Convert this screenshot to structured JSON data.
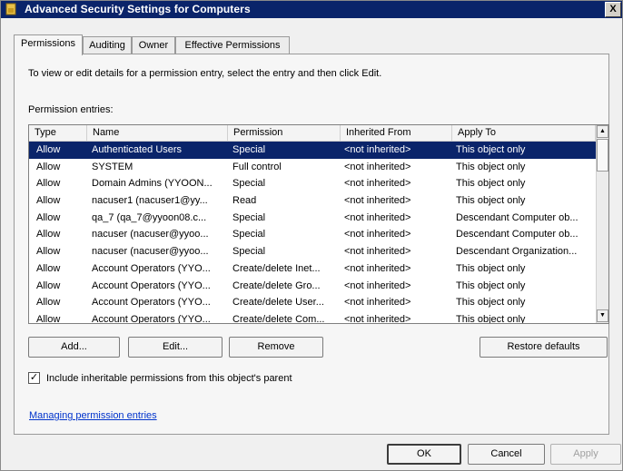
{
  "window": {
    "title": "Advanced Security Settings for Computers",
    "close_glyph": "X"
  },
  "tabs": [
    {
      "label": "Permissions",
      "active": true
    },
    {
      "label": "Auditing",
      "active": false
    },
    {
      "label": "Owner",
      "active": false
    },
    {
      "label": "Effective Permissions",
      "active": false
    }
  ],
  "instructions": "To view or edit details for a permission entry, select the entry and then click Edit.",
  "entries_label": "Permission entries:",
  "table": {
    "columns": [
      "Type",
      "Name",
      "Permission",
      "Inherited From",
      "Apply To"
    ],
    "rows": [
      [
        "Allow",
        "Authenticated Users",
        "Special",
        "<not inherited>",
        "This object only"
      ],
      [
        "Allow",
        "SYSTEM",
        "Full control",
        "<not inherited>",
        "This object only"
      ],
      [
        "Allow",
        "Domain Admins (YYOON...",
        "Special",
        "<not inherited>",
        "This object only"
      ],
      [
        "Allow",
        "nacuser1 (nacuser1@yy...",
        "Read",
        "<not inherited>",
        "This object only"
      ],
      [
        "Allow",
        "qa_7 (qa_7@yyoon08.c...",
        "Special",
        "<not inherited>",
        "Descendant Computer ob..."
      ],
      [
        "Allow",
        "nacuser (nacuser@yyoo...",
        "Special",
        "<not inherited>",
        "Descendant Computer ob..."
      ],
      [
        "Allow",
        "nacuser (nacuser@yyoo...",
        "Special",
        "<not inherited>",
        "Descendant Organization..."
      ],
      [
        "Allow",
        "Account Operators (YYO...",
        "Create/delete Inet...",
        "<not inherited>",
        "This object only"
      ],
      [
        "Allow",
        "Account Operators (YYO...",
        "Create/delete Gro...",
        "<not inherited>",
        "This object only"
      ],
      [
        "Allow",
        "Account Operators (YYO...",
        "Create/delete User...",
        "<not inherited>",
        "This object only"
      ],
      [
        "Allow",
        "Account Operators (YYO...",
        "Create/delete Com...",
        "<not inherited>",
        "This object only"
      ]
    ],
    "selected_row": 0
  },
  "buttons": {
    "add": "Add...",
    "edit": "Edit...",
    "remove": "Remove",
    "restore": "Restore defaults",
    "ok": "OK",
    "cancel": "Cancel",
    "apply": "Apply"
  },
  "inherit_checkbox": {
    "label": "Include inheritable permissions from this object's parent",
    "checked": true
  },
  "link": "Managing permission entries"
}
